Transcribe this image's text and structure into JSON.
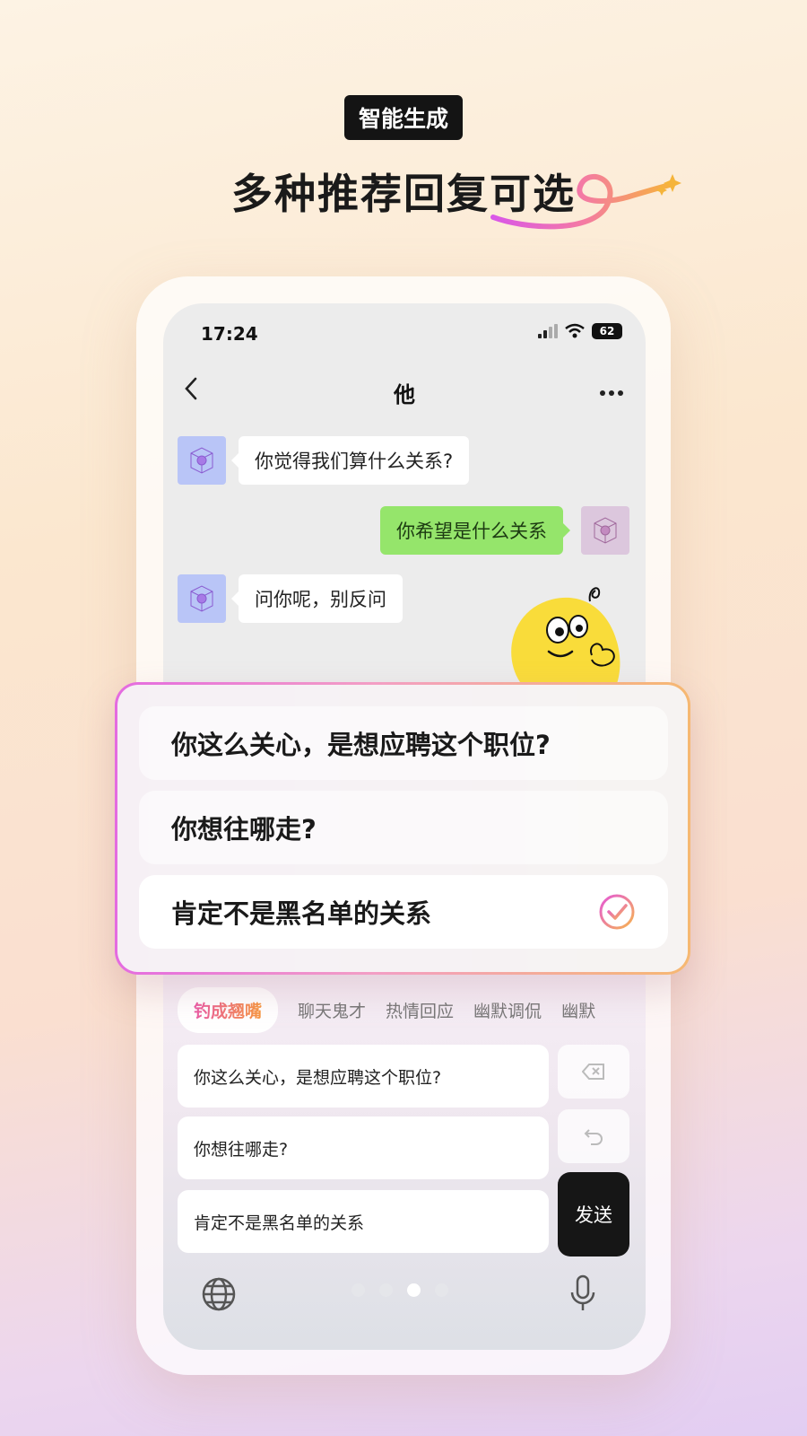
{
  "promo": {
    "badge": "智能生成",
    "headline": "多种推荐回复可选"
  },
  "status_bar": {
    "time": "17:24",
    "battery": "62"
  },
  "nav": {
    "back_icon": "chevron-left-icon",
    "title": "他",
    "more_icon": "more-dots-icon"
  },
  "messages": [
    {
      "side": "left",
      "text": "你觉得我们算什么关系?"
    },
    {
      "side": "right",
      "text": "你希望是什么关系"
    },
    {
      "side": "left",
      "text": "问你呢，别反问"
    }
  ],
  "suggestions": [
    {
      "text": "你这么关心，是想应聘这个职位?"
    },
    {
      "text": "你想往哪走?"
    },
    {
      "text": "肯定不是黑名单的关系",
      "selected": true
    }
  ],
  "style_tabs": [
    "钓成翘嘴",
    "聊天鬼才",
    "热情回应",
    "幽默调侃",
    "幽默"
  ],
  "reply_options": [
    "你这么关心，是想应聘这个职位?",
    "你想往哪走?",
    "肯定不是黑名单的关系"
  ],
  "keyboard": {
    "delete_icon": "backspace-icon",
    "undo_icon": "undo-icon",
    "send_label": "发送",
    "globe_icon": "globe-icon",
    "mic_icon": "microphone-icon",
    "page_dots": 4,
    "active_dot": 3
  },
  "colors": {
    "green_bubble": "#95e56b",
    "accent_pink": "#e46be0",
    "accent_orange": "#f6b871",
    "send_button": "#161616"
  }
}
